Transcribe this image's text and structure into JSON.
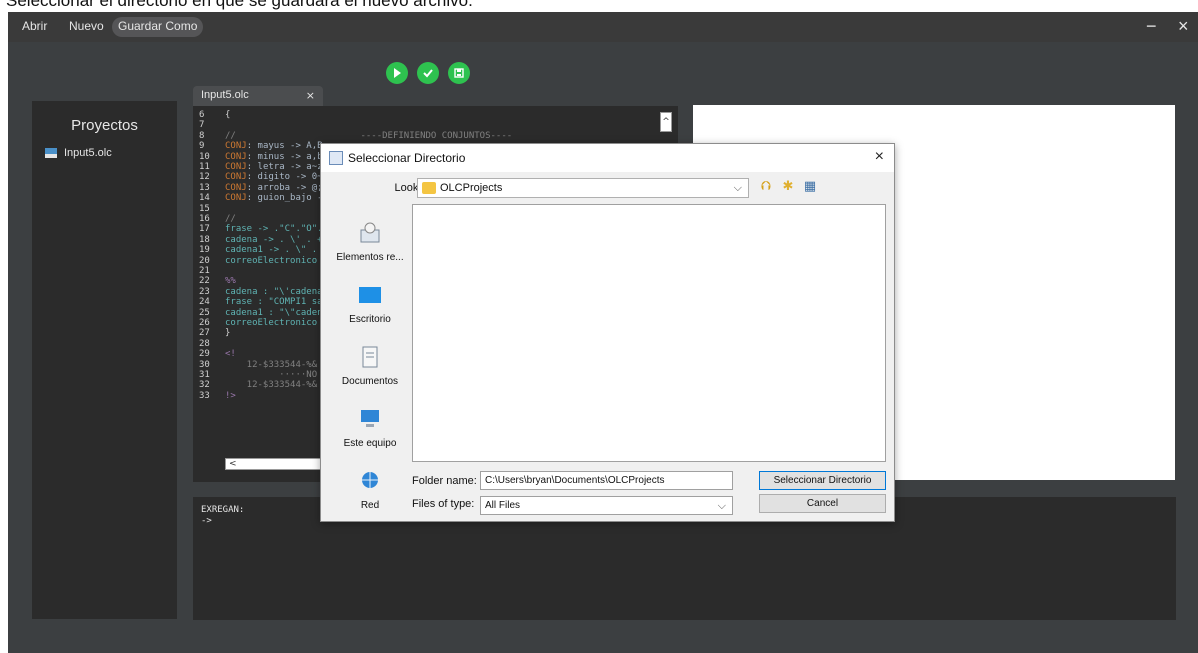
{
  "caption": "Seleccionar el directorio en que se guardará el nuevo archivo.",
  "menubar": {
    "items": [
      "Abrir",
      "Nuevo",
      "Guardar Como"
    ],
    "minimize": "−",
    "close": "×"
  },
  "toolbar": {
    "run_icon": "play-icon",
    "check_icon": "check-icon",
    "save_icon": "save-icon"
  },
  "projects": {
    "title": "Proyectos",
    "items": [
      {
        "label": "Input5.olc",
        "icon": "olc-file-icon"
      }
    ]
  },
  "editor": {
    "tab": {
      "label": "Input5.olc",
      "close": "×"
    },
    "lines": [
      {
        "n": "6",
        "t": "{"
      },
      {
        "n": "7",
        "t": ""
      },
      {
        "n": "8",
        "t": "//                       ----DEFINIENDO CONJUNTOS----"
      },
      {
        "n": "9",
        "t": "CONJ: mayus -> A,B"
      },
      {
        "n": "10",
        "t": "CONJ: minus -> a,b"
      },
      {
        "n": "11",
        "t": "CONJ: letra -> a~z"
      },
      {
        "n": "12",
        "t": "CONJ: digito -> 0~"
      },
      {
        "n": "13",
        "t": "CONJ: arroba -> @;"
      },
      {
        "n": "14",
        "t": "CONJ: guion_bajo -"
      },
      {
        "n": "15",
        "t": ""
      },
      {
        "n": "16",
        "t": "//"
      },
      {
        "n": "17",
        "t": "frase -> .\"C\".\"O\"."
      },
      {
        "n": "18",
        "t": "cadena -> . \\' . +"
      },
      {
        "n": "19",
        "t": "cadena1 -> . \\\" ."
      },
      {
        "n": "20",
        "t": "correoElectronico"
      },
      {
        "n": "21",
        "t": ""
      },
      {
        "n": "22",
        "t": "%%"
      },
      {
        "n": "23",
        "t": "cadena : \"\\'cadena"
      },
      {
        "n": "24",
        "t": "frase : \"COMPI1 sa"
      },
      {
        "n": "25",
        "t": "cadena1 : \"\\\"caden"
      },
      {
        "n": "26",
        "t": "correoElectronico"
      },
      {
        "n": "27",
        "t": "}"
      },
      {
        "n": "28",
        "t": ""
      },
      {
        "n": "29",
        "t": "<!"
      },
      {
        "n": "30",
        "t": "    12-$333544-%&"
      },
      {
        "n": "31",
        "t": "          ·····NO"
      },
      {
        "n": "32",
        "t": "    12-$333544-%&"
      },
      {
        "n": "33",
        "t": "!>"
      }
    ],
    "scroll_up": "^",
    "scroll_left": "<"
  },
  "console": {
    "lines": [
      "EXREGAN:",
      "->"
    ]
  },
  "dialog": {
    "title": "Seleccionar Directorio",
    "close": "×",
    "look_in_label": "Look in:",
    "look_in_value": "OLCProjects",
    "places": [
      {
        "label": "Elementos re...",
        "icon": "recent-items-icon"
      },
      {
        "label": "Escritorio",
        "icon": "desktop-icon"
      },
      {
        "label": "Documentos",
        "icon": "documents-icon"
      },
      {
        "label": "Este equipo",
        "icon": "computer-icon"
      },
      {
        "label": "Red",
        "icon": "network-icon"
      }
    ],
    "folder_name_label": "Folder name:",
    "folder_name_value": "C:\\Users\\bryan\\Documents\\OLCProjects",
    "files_of_type_label": "Files of type:",
    "files_of_type_value": "All Files",
    "select_button": "Seleccionar Directorio",
    "cancel_button": "Cancel"
  },
  "colors": {
    "app_bg": "#3c3f41",
    "panel_bg": "#2b2b2b",
    "toolbar_green": "#2ec24f",
    "keyword": "#cc7832",
    "comment": "#808080"
  }
}
